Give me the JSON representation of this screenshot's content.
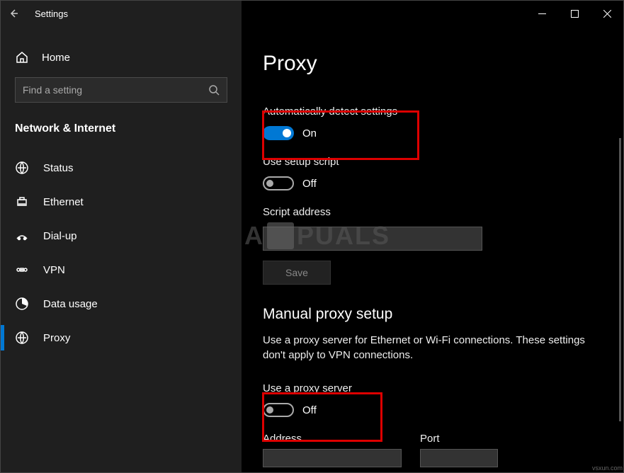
{
  "titlebar": {
    "title": "Settings"
  },
  "sidebar": {
    "home": "Home",
    "search_placeholder": "Find a setting",
    "category": "Network & Internet",
    "items": [
      {
        "label": "Status"
      },
      {
        "label": "Ethernet"
      },
      {
        "label": "Dial-up"
      },
      {
        "label": "VPN"
      },
      {
        "label": "Data usage"
      },
      {
        "label": "Proxy"
      }
    ]
  },
  "content": {
    "page_title": "Proxy",
    "auto_detect_label": "Automatically detect settings",
    "auto_detect_state": "On",
    "setup_script_label": "Use setup script",
    "setup_script_state": "Off",
    "script_address_label": "Script address",
    "save_label": "Save",
    "manual_title": "Manual proxy setup",
    "manual_desc": "Use a proxy server for Ethernet or Wi-Fi connections. These settings don't apply to VPN connections.",
    "use_proxy_label": "Use a proxy server",
    "use_proxy_state": "Off",
    "address_label": "Address",
    "port_label": "Port"
  },
  "watermark": "A  PUALS",
  "source": "vsxun.com"
}
